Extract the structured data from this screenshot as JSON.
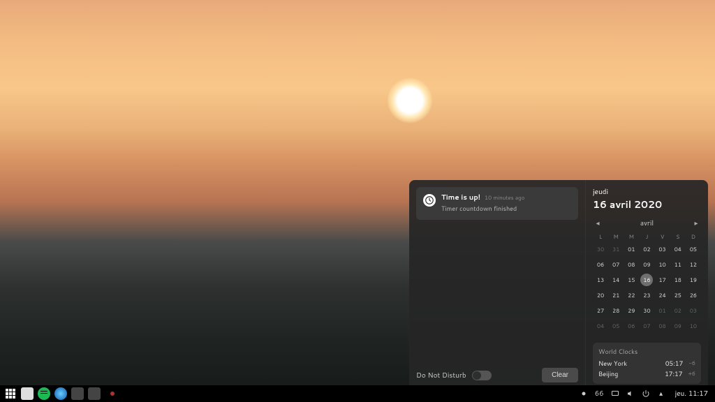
{
  "notification": {
    "title": "Time is up!",
    "timestamp": "10 minutes ago",
    "body": "Timer countdown finished"
  },
  "dnd": {
    "label": "Do Not Disturb"
  },
  "clear": {
    "label": "Clear"
  },
  "date": {
    "dow": "jeudi",
    "full": "16 avril 2020",
    "month_label": "avril"
  },
  "weekdays": [
    "L",
    "M",
    "M",
    "J",
    "V",
    "S",
    "D"
  ],
  "cal": {
    "r0": [
      "30",
      "31",
      "01",
      "02",
      "03",
      "04",
      "05"
    ],
    "r1": [
      "06",
      "07",
      "08",
      "09",
      "10",
      "11",
      "12"
    ],
    "r2": [
      "13",
      "14",
      "15",
      "16",
      "17",
      "18",
      "19"
    ],
    "r3": [
      "20",
      "21",
      "22",
      "23",
      "24",
      "25",
      "26"
    ],
    "r4": [
      "27",
      "28",
      "29",
      "30",
      "01",
      "02",
      "03"
    ],
    "r5": [
      "04",
      "05",
      "06",
      "07",
      "08",
      "09",
      "10"
    ]
  },
  "world_clocks": {
    "title": "World Clocks",
    "rows": [
      {
        "city": "New York",
        "time": "05:17",
        "offset": "-6"
      },
      {
        "city": "Beijing",
        "time": "17:17",
        "offset": "+6"
      }
    ]
  },
  "tray": {
    "number": "66"
  },
  "clock": {
    "text": "jeu. 11:17"
  }
}
